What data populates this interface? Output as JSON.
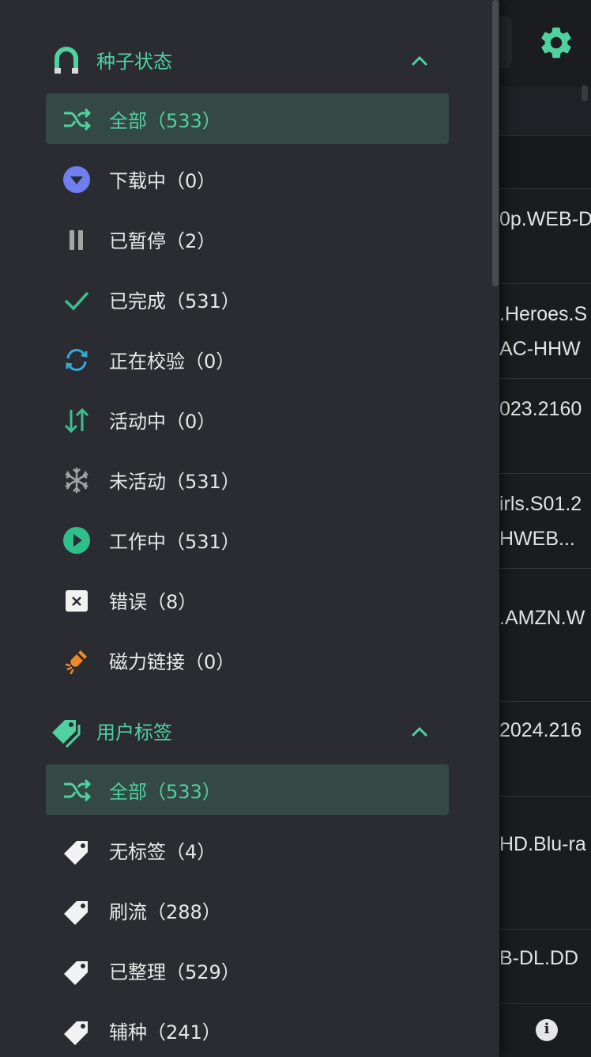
{
  "colors": {
    "accent": "#4fd1a1",
    "drawer_bg": "#2b2c31",
    "active_bg": "#344844",
    "text": "#e8e8e8",
    "downloading": "#6f7ff0",
    "checking": "#35a9d9",
    "magnet": "#f08a24"
  },
  "background": {
    "row_texts": [
      "0p.WEB-D",
      ".Heroes.S",
      "AC-HHW",
      "023.2160",
      "irls.S01.2",
      "HWEB...",
      ".AMZN.W",
      "2024.216",
      "HD.Blu-ra",
      "B-DL.DD"
    ]
  },
  "torrent_status": {
    "title": "种子状态",
    "icon": "horseshoe-magnet-icon",
    "items": [
      {
        "label": "全部（533）",
        "icon": "shuffle-icon"
      },
      {
        "label": "下载中（0）",
        "icon": "download-circle-icon"
      },
      {
        "label": "已暂停（2）",
        "icon": "pause-icon"
      },
      {
        "label": "已完成（531）",
        "icon": "check-icon"
      },
      {
        "label": "正在校验（0）",
        "icon": "sync-icon"
      },
      {
        "label": "活动中（0）",
        "icon": "up-down-arrows-icon"
      },
      {
        "label": "未活动（531）",
        "icon": "snowflake-icon"
      },
      {
        "label": "工作中（531）",
        "icon": "play-circle-icon"
      },
      {
        "label": "错误（8）",
        "icon": "error-x-icon"
      },
      {
        "label": "磁力链接（0）",
        "icon": "magnet-icon"
      }
    ]
  },
  "user_tags": {
    "title": "用户标签",
    "icon": "tags-icon",
    "items": [
      {
        "label": "全部（533）",
        "icon": "shuffle-icon"
      },
      {
        "label": "无标签（4）",
        "icon": "tag-icon"
      },
      {
        "label": "刷流（288）",
        "icon": "tag-icon"
      },
      {
        "label": "已整理（529）",
        "icon": "tag-icon"
      },
      {
        "label": "辅种（241）",
        "icon": "tag-icon"
      }
    ]
  }
}
